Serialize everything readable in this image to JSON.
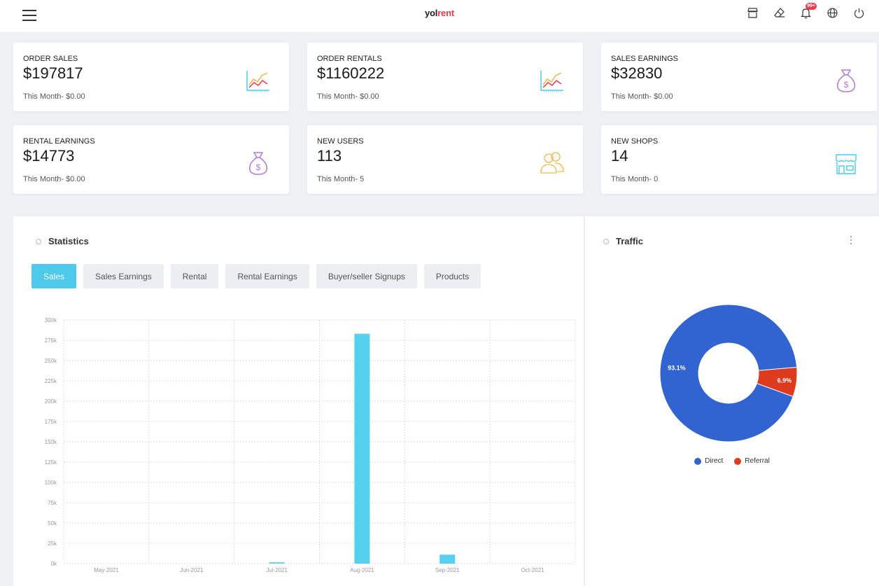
{
  "header": {
    "logo_part1": "yol",
    "logo_part2": "rent",
    "notification_badge": "99+",
    "icons": [
      "menu-icon",
      "store-icon",
      "eraser-icon",
      "bell-icon",
      "globe-icon",
      "power-icon"
    ]
  },
  "cards": [
    {
      "label": "ORDER SALES",
      "value": "$197817",
      "sub": "This Month- $0.00",
      "icon": "line-chart-icon"
    },
    {
      "label": "ORDER RENTALS",
      "value": "$1160222",
      "sub": "This Month- $0.00",
      "icon": "line-chart-icon"
    },
    {
      "label": "SALES EARNINGS",
      "value": "$32830",
      "sub": "This Month- $0.00",
      "icon": "money-bag-icon"
    },
    {
      "label": "RENTAL EARNINGS",
      "value": "$14773",
      "sub": "This Month- $0.00",
      "icon": "money-bag-icon"
    },
    {
      "label": "NEW USERS",
      "value": "113",
      "sub": "This Month- 5",
      "icon": "users-icon"
    },
    {
      "label": "NEW SHOPS",
      "value": "14",
      "sub": "This Month- 0",
      "icon": "shop-icon"
    }
  ],
  "statistics": {
    "title": "Statistics",
    "tabs": [
      "Sales",
      "Sales Earnings",
      "Rental",
      "Rental Earnings",
      "Buyer/seller Signups",
      "Products"
    ],
    "active_tab": "Sales"
  },
  "traffic": {
    "title": "Traffic",
    "legend": [
      "Direct",
      "Referral"
    ]
  },
  "colors": {
    "accent": "#4dc9ea",
    "brand_red": "#ee3a4a",
    "purple_icon": "#b679d9",
    "orange_icon": "#f5b64a",
    "cyan_icon": "#4dc9ea",
    "direct": "#3164d0",
    "referral": "#dd3a1e"
  },
  "chart_data": [
    {
      "type": "bar",
      "categories": [
        "May-2021",
        "Jun-2021",
        "Jul-2021",
        "Aug-2021",
        "Sep-2021",
        "Oct-2021"
      ],
      "values": [
        0,
        0,
        1500,
        283000,
        11000,
        0
      ],
      "ylim": [
        0,
        300000
      ],
      "yticks": [
        "0k",
        "25k",
        "50k",
        "75k",
        "100k",
        "125k",
        "150k",
        "175k",
        "200k",
        "225k",
        "250k",
        "275k",
        "300k"
      ],
      "ytick_values": [
        0,
        25000,
        50000,
        75000,
        100000,
        125000,
        150000,
        175000,
        200000,
        225000,
        250000,
        275000,
        300000
      ],
      "grid": true,
      "color": "#55d0ee"
    },
    {
      "type": "pie",
      "donut": true,
      "labels": [
        "Direct",
        "Referral"
      ],
      "values": [
        93.1,
        6.9
      ],
      "data_labels": [
        "93.1%",
        "6.9%"
      ],
      "colors": [
        "#3164d0",
        "#dd3a1e"
      ],
      "legend_position": "bottom"
    }
  ]
}
